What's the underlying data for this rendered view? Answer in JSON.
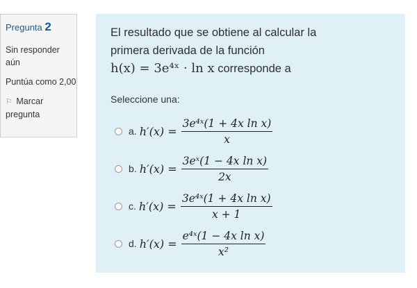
{
  "info": {
    "question_label": "Pregunta",
    "question_number": "2",
    "status": "Sin responder aún",
    "grade": "Puntúa como 2,00",
    "flag_label": "Marcar pregunta",
    "flag_icon": "flag-icon"
  },
  "question": {
    "text_line1": "El resultado que se obtiene al calcular la",
    "text_line2": "primera derivada de la función",
    "formula": "h(x) = 3e⁴ˣ · ln x",
    "text_tail": " corresponde a",
    "prompt": "Seleccione una:"
  },
  "options": [
    {
      "letter": "a.",
      "lhs": "h′(x) =",
      "numerator": "3e⁴ˣ(1 + 4x ln x)",
      "denominator": "x"
    },
    {
      "letter": "b.",
      "lhs": "h′(x) =",
      "numerator": "3eˣ(1 − 4x ln x)",
      "denominator": "2x"
    },
    {
      "letter": "c.",
      "lhs": "h′(x) =",
      "numerator": "3e⁴ˣ(1 + 4x ln x)",
      "denominator": "x + 1"
    },
    {
      "letter": "d.",
      "lhs": "h′(x) =",
      "numerator": "e⁴ˣ(1 − 4x ln x)",
      "denominator": "x²"
    }
  ],
  "colors": {
    "panel_bg": "#dff0f7",
    "info_bg": "#f5f5f5",
    "question_number": "#1a5a8f"
  }
}
